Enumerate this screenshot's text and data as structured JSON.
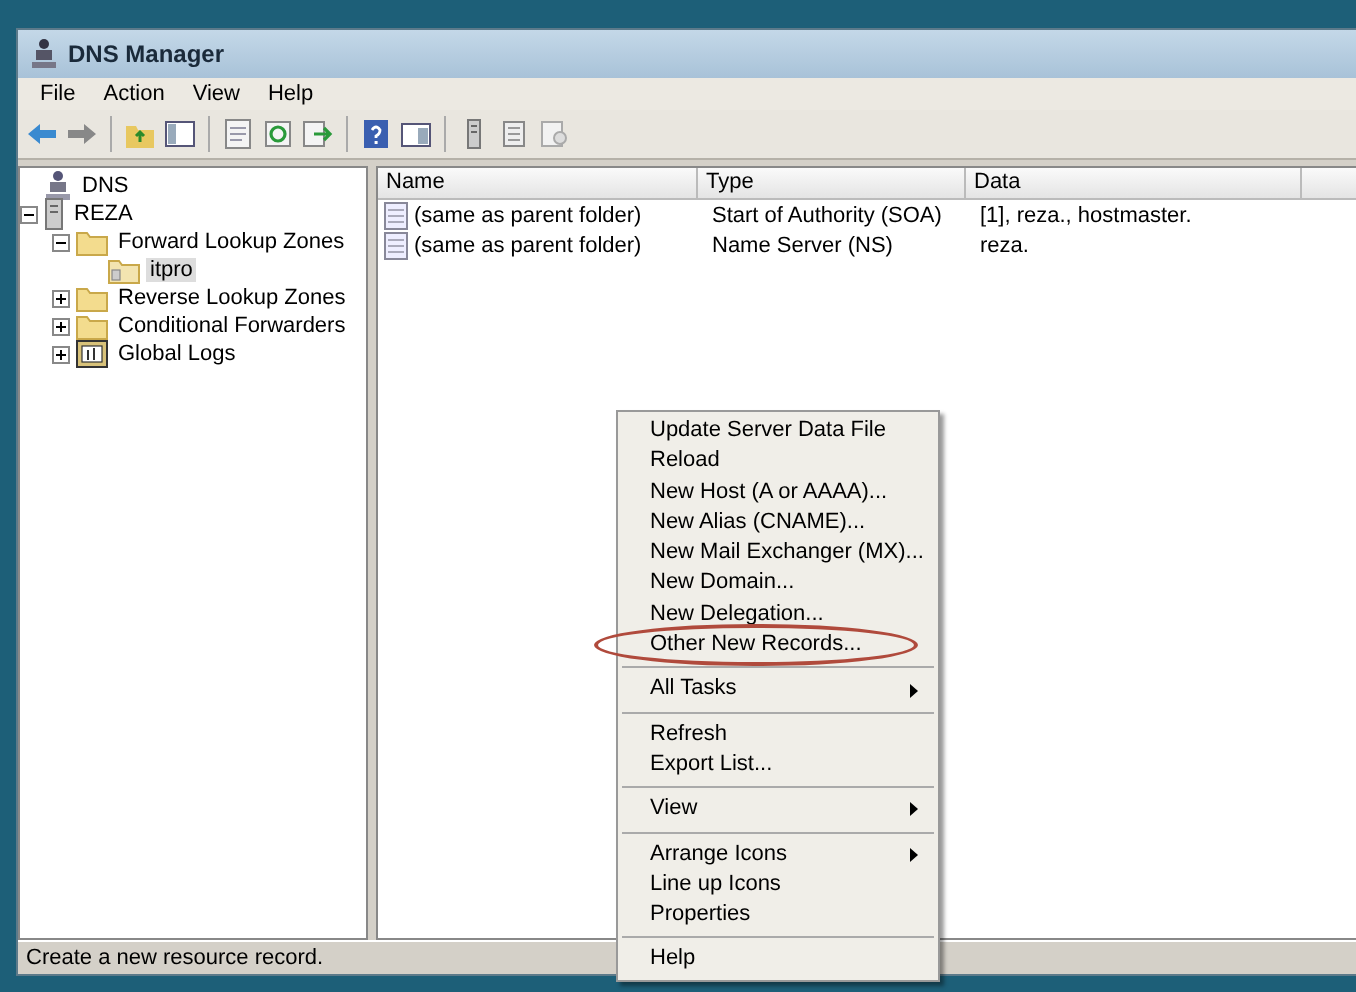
{
  "window": {
    "title": "DNS Manager"
  },
  "menu_bar": [
    "File",
    "Action",
    "View",
    "Help"
  ],
  "tree": [
    {
      "label": "DNS",
      "kind": "dns",
      "selected": false,
      "children": [
        {
          "label": "REZA",
          "kind": "server",
          "expanded": true,
          "selected": false,
          "children": [
            {
              "label": "Forward Lookup Zones",
              "kind": "folder",
              "expanded": true,
              "selected": false,
              "children": [
                {
                  "label": "itpro",
                  "kind": "zone",
                  "selected": true
                }
              ]
            },
            {
              "label": "Reverse Lookup Zones",
              "kind": "folder",
              "expanded": false,
              "selected": false
            },
            {
              "label": "Conditional Forwarders",
              "kind": "folder",
              "expanded": false,
              "selected": false
            },
            {
              "label": "Global Logs",
              "kind": "logs",
              "expanded": false,
              "selected": false
            }
          ]
        }
      ]
    }
  ],
  "table": {
    "columns": [
      "Name",
      "Type",
      "Data"
    ],
    "rows": [
      [
        "(same as parent folder)",
        "Start of Authority (SOA)",
        "[1], reza., hostmaster."
      ],
      [
        "(same as parent folder)",
        "Name Server (NS)",
        "reza."
      ]
    ]
  },
  "context_menu": [
    {
      "kind": "item",
      "label": "Update Server Data File"
    },
    {
      "kind": "item",
      "label": "Reload"
    },
    {
      "kind": "item",
      "label": "New Host (A or AAAA)..."
    },
    {
      "kind": "item",
      "label": "New Alias (CNAME)..."
    },
    {
      "kind": "item",
      "label": "New Mail Exchanger (MX)..."
    },
    {
      "kind": "item",
      "label": "New Domain..."
    },
    {
      "kind": "item",
      "label": "New Delegation..."
    },
    {
      "kind": "item",
      "label": "Other New Records...",
      "highlighted": true
    },
    {
      "kind": "separator"
    },
    {
      "kind": "submenu",
      "label": "All Tasks"
    },
    {
      "kind": "separator"
    },
    {
      "kind": "item",
      "label": "Refresh"
    },
    {
      "kind": "item",
      "label": "Export List..."
    },
    {
      "kind": "separator"
    },
    {
      "kind": "submenu",
      "label": "View"
    },
    {
      "kind": "separator"
    },
    {
      "kind": "submenu",
      "label": "Arrange Icons"
    },
    {
      "kind": "item",
      "label": "Line up Icons"
    },
    {
      "kind": "item",
      "label": "Properties"
    },
    {
      "kind": "separator"
    },
    {
      "kind": "item",
      "label": "Help"
    }
  ],
  "status_bar": "Create a new resource record."
}
